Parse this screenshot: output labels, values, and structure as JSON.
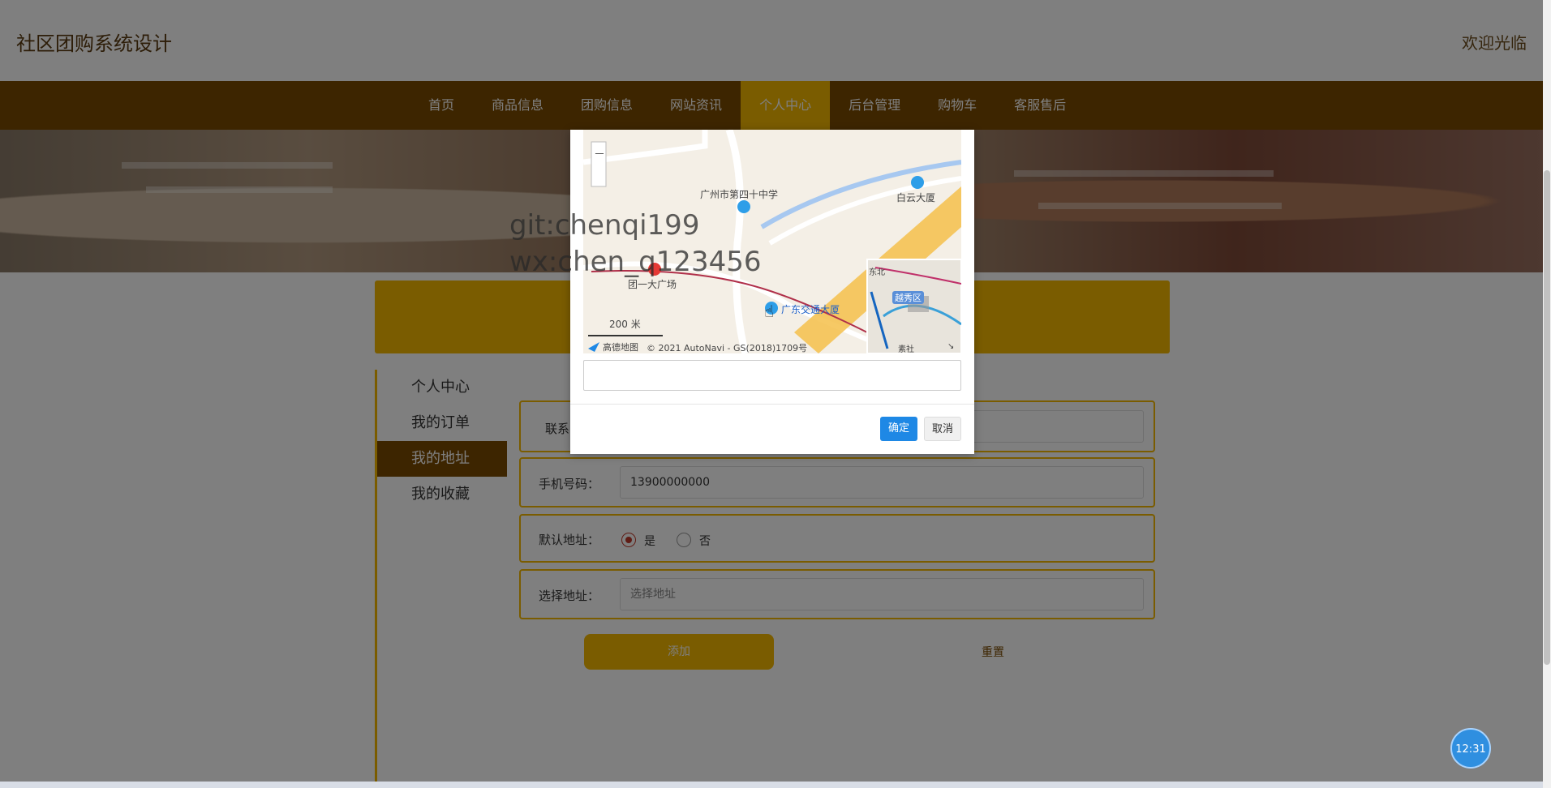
{
  "header": {
    "site_title": "社区团购系统设计",
    "welcome": "欢迎光临"
  },
  "nav": {
    "items": [
      "首页",
      "商品信息",
      "团购信息",
      "网站资讯",
      "个人中心",
      "后台管理",
      "购物车",
      "客服售后"
    ],
    "active": "个人中心"
  },
  "sidebar": {
    "items": [
      "个人中心",
      "我的订单",
      "我的地址",
      "我的收藏"
    ],
    "active": "我的地址"
  },
  "form": {
    "contact_label": "联系",
    "phone_label": "手机号码：",
    "phone_value": "13900000000",
    "default_label": "默认地址：",
    "default_yes": "是",
    "default_no": "否",
    "address_label": "选择地址：",
    "address_placeholder": "选择地址",
    "add_button": "添加",
    "reset_button": "重置"
  },
  "map_modal": {
    "labels": {
      "school": "广州市第四十中学",
      "baiyun": "白云大厦",
      "square": "团一大广场",
      "transport": "广东交通大厦",
      "scale": "200 米",
      "logo": "高德地图",
      "copyright": "© 2021 AutoNavi - GS(2018)1709号",
      "district": "越秀区",
      "north": "东北",
      "suse": "素社"
    },
    "ok_button": "确定",
    "cancel_button": "取消"
  },
  "watermark": {
    "line1": "git:chenqi199",
    "line2": "wx:chen_q123456"
  },
  "clock": {
    "time": "12:31"
  },
  "colors": {
    "brand_brown": "#7a4a00",
    "brand_gold": "#f5b800",
    "confirm_blue": "#1e88e5"
  }
}
